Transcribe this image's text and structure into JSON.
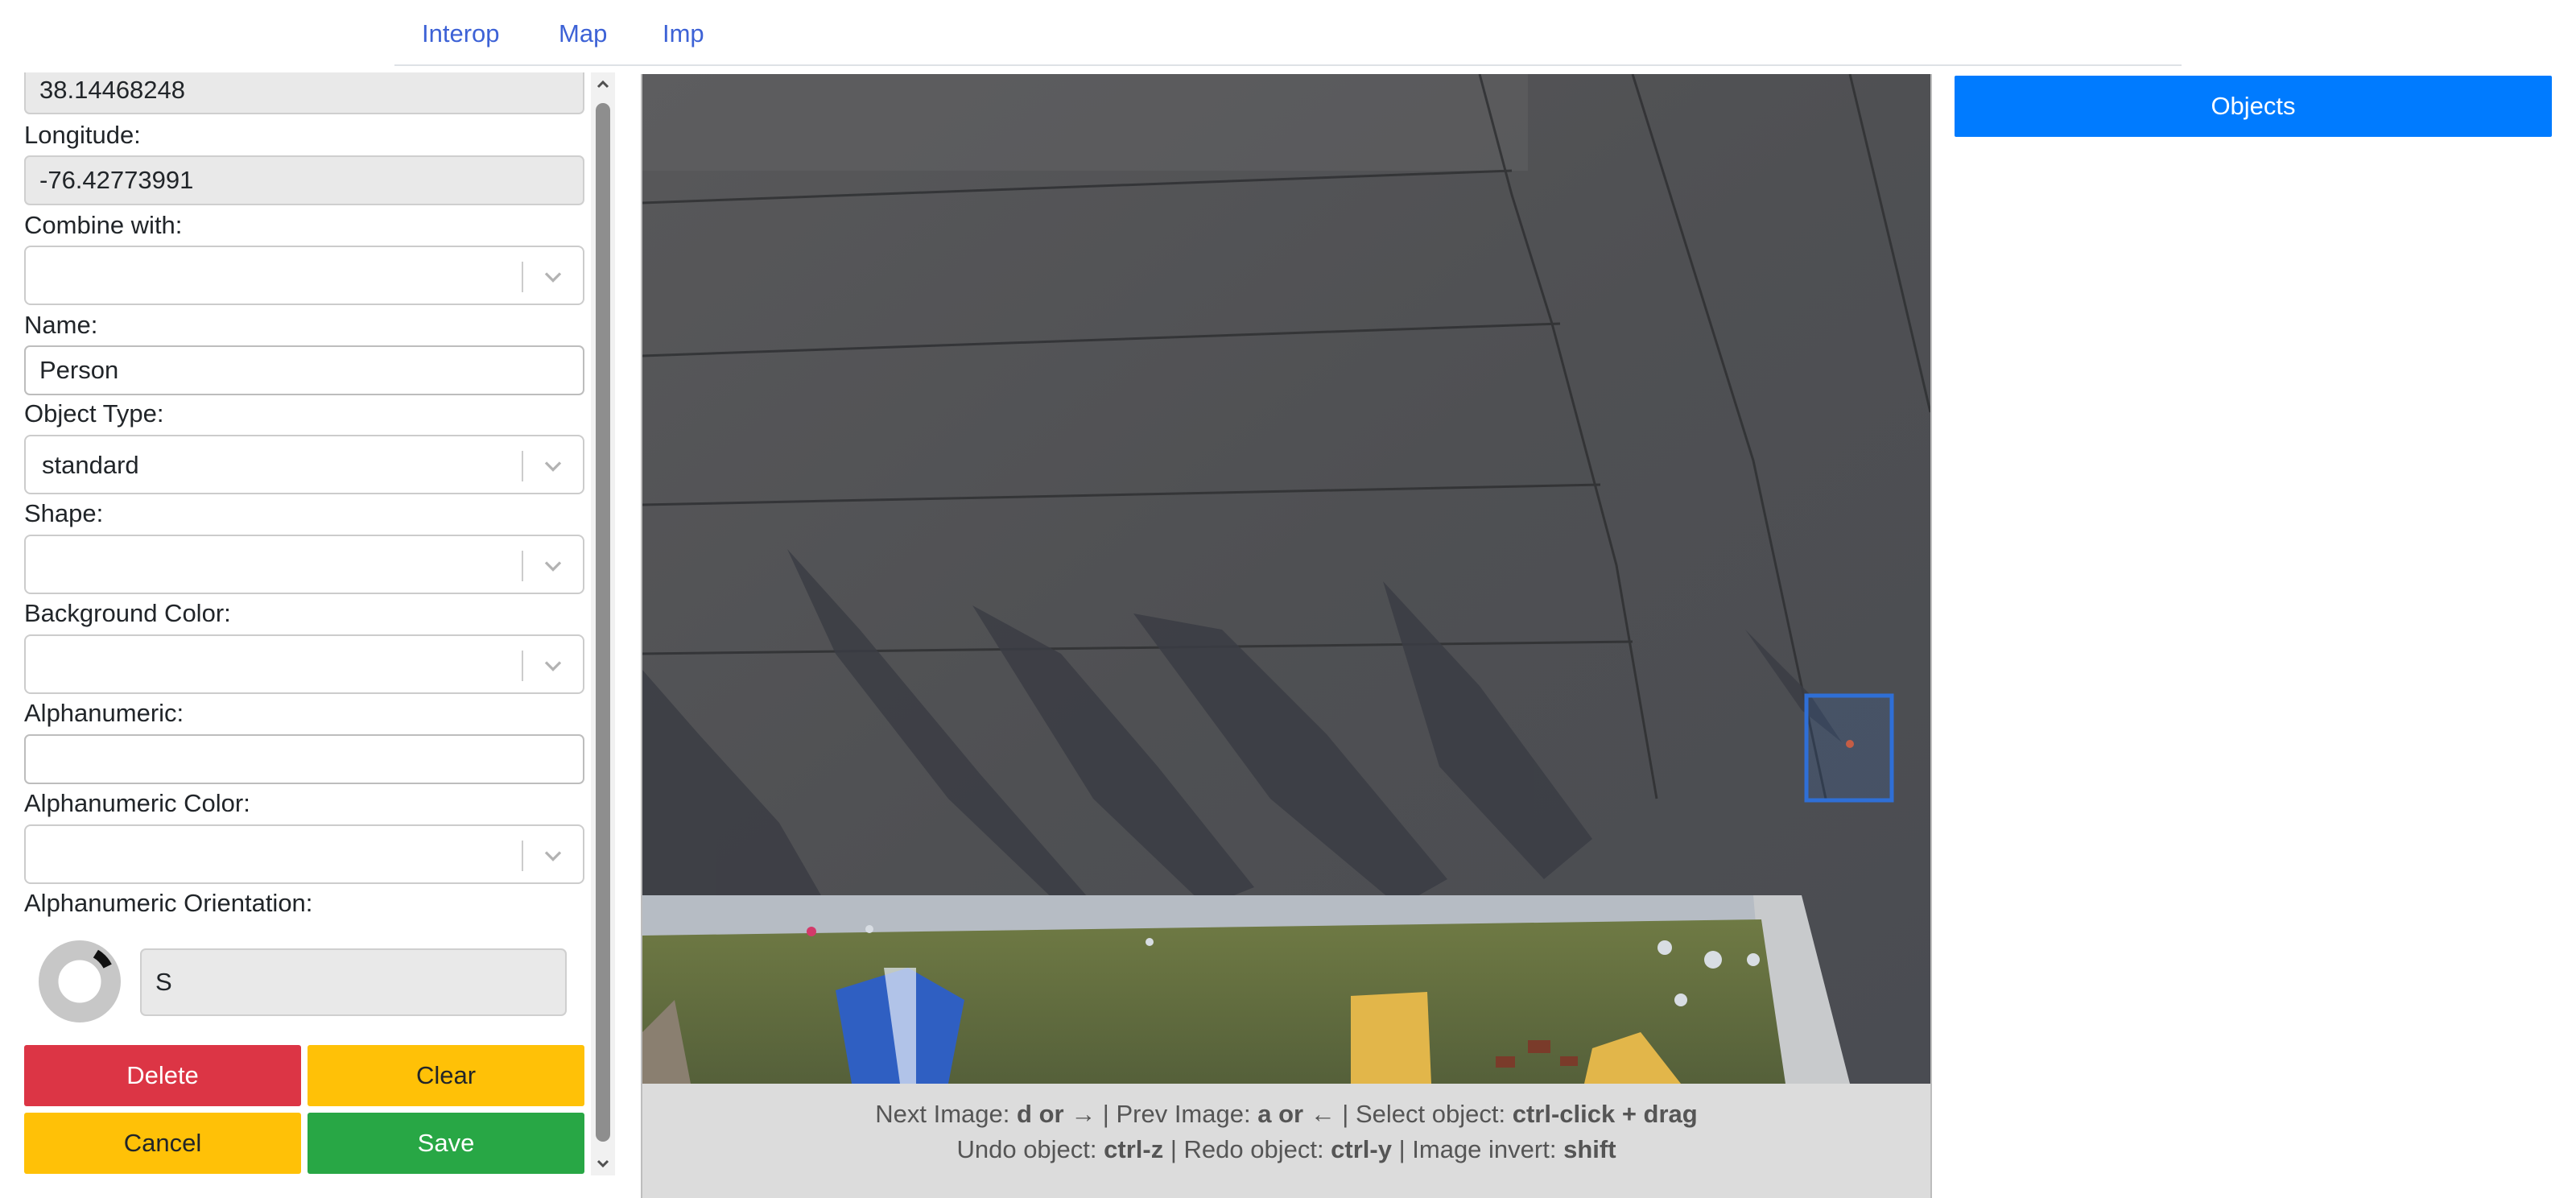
{
  "nav": {
    "tabs": [
      {
        "label": "Interop"
      },
      {
        "label": "Map"
      },
      {
        "label": "Imp"
      }
    ]
  },
  "form": {
    "latitude_value": "38.14468248",
    "longitude_label": "Longitude:",
    "longitude_value": "-76.42773991",
    "combine_label": "Combine with:",
    "combine_value": "",
    "name_label": "Name:",
    "name_value": "Person",
    "object_type_label": "Object Type:",
    "object_type_value": "standard",
    "shape_label": "Shape:",
    "shape_value": "",
    "bg_color_label": "Background Color:",
    "bg_color_value": "",
    "alnum_label": "Alphanumeric:",
    "alnum_value": "",
    "alnum_color_label": "Alphanumeric Color:",
    "alnum_color_value": "",
    "orientation_label": "Alphanumeric Orientation:",
    "orientation_value": "S"
  },
  "buttons": {
    "delete": "Delete",
    "clear": "Clear",
    "cancel": "Cancel",
    "save": "Save"
  },
  "help": {
    "line1": [
      {
        "text": "Next Image: "
      },
      {
        "key": "d or"
      },
      {
        "text": " → | Prev Image: "
      },
      {
        "key": "a or"
      },
      {
        "text": " ← | Select object: "
      },
      {
        "key": "ctrl-click + drag"
      }
    ],
    "line2": [
      {
        "text": "Undo object: "
      },
      {
        "key": "ctrl-z"
      },
      {
        "text": " | Redo object: "
      },
      {
        "key": "ctrl-y"
      },
      {
        "text": " | Image invert: "
      },
      {
        "key": "shift"
      }
    ]
  },
  "sidebar": {
    "objects_label": "Objects"
  },
  "colors": {
    "delete": "#dc3545",
    "warning": "#ffc107",
    "save": "#28a745",
    "primary": "#007bff",
    "link": "#3d62d6",
    "selection_box": "#2f6fd6"
  }
}
